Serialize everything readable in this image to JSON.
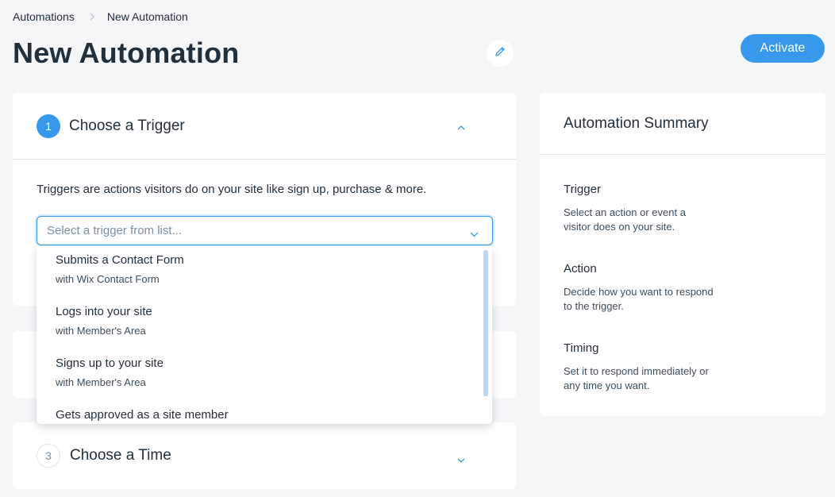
{
  "breadcrumb": {
    "parent": "Automations",
    "current": "New Automation"
  },
  "header": {
    "title": "New Automation",
    "activate_label": "Activate"
  },
  "colors": {
    "accent": "#3899ec",
    "text": "#20303c",
    "muted": "#7a92a5"
  },
  "step1": {
    "number": "1",
    "title": "Choose a Trigger",
    "description": "Triggers are actions visitors do on your site like sign up, purchase & more.",
    "select_placeholder": "Select a trigger from list...",
    "options": [
      {
        "title": "Submits a Contact Form",
        "subtitle": "with Wix Contact Form"
      },
      {
        "title": "Logs into your site",
        "subtitle": "with Member's Area"
      },
      {
        "title": "Signs up to your site",
        "subtitle": "with Member's Area"
      },
      {
        "title": "Gets approved as a site member",
        "subtitle": ""
      }
    ]
  },
  "step3": {
    "number": "3",
    "title": "Choose a Time"
  },
  "summary": {
    "title": "Automation Summary",
    "blocks": [
      {
        "heading": "Trigger",
        "text": "Select an action or event a visitor does on your site."
      },
      {
        "heading": "Action",
        "text": "Decide how you want to respond to the trigger."
      },
      {
        "heading": "Timing",
        "text": "Set it to respond immediately or any time you want."
      }
    ]
  }
}
